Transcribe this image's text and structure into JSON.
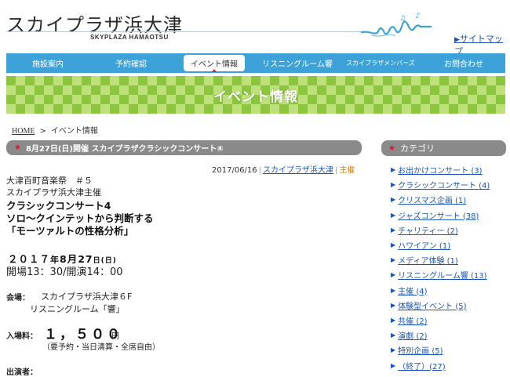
{
  "header": {
    "site_title": "スカイプラザ浜大津",
    "site_subtitle": "SKYPLAZA HAMAOTSU",
    "sitemap_label": "サイトマップ"
  },
  "nav": {
    "items": [
      {
        "label": "施設案内"
      },
      {
        "label": "予約確認"
      },
      {
        "label": "イベント情報"
      },
      {
        "label": "リスニングルーム響"
      },
      {
        "label": "スカイプラザメンバーズ"
      },
      {
        "label": "お問合わせ"
      }
    ],
    "active_index": 2
  },
  "banner": {
    "title": "イベント情報"
  },
  "breadcrumb": {
    "home": "HOME",
    "separator": ">",
    "current": "イベント情報"
  },
  "post": {
    "header": "8月27日(日)開催 スカイプラザクラシックコンサート④",
    "date": "2017/06/16",
    "author": "スカイプラザ浜大津",
    "category": "主催",
    "line1": "大津百町音楽祭　＃５",
    "line2": "スカイプラザ浜大津主催",
    "title1": "クラシックコンサート4",
    "title2": "ソロ～クインテットから判断する",
    "title3": "「モーツァルトの性格分析」",
    "event_year": "２０１７",
    "event_year_unit": "年",
    "event_month_day": "8月27",
    "event_day_unit": "日",
    "event_weekday": "(日)",
    "event_time": "開場13：30/開演14：00",
    "venue_label": "会場：",
    "venue_line1": "スカイプラザ浜大津６F",
    "venue_line2": "リスニングルーム「響」",
    "fee_label": "入場料：",
    "fee_amount": "１，５００",
    "fee_unit": "円",
    "fee_note": "（要予約・当日清算・全席自由）",
    "performers_label": "出演者："
  },
  "sidebar": {
    "title": "カテゴリ",
    "categories": [
      {
        "label": "お出かけコンサート (3)"
      },
      {
        "label": "クラシックコンサート (4)"
      },
      {
        "label": "クリスマス企画 (1)"
      },
      {
        "label": "ジャズコンサート (38)"
      },
      {
        "label": "チャリティー (2)"
      },
      {
        "label": "ハワイアン (1)"
      },
      {
        "label": "メディア体験 (1)"
      },
      {
        "label": "リスニングルーム響 (13)"
      },
      {
        "label": "主催 (4)"
      },
      {
        "label": "体験型イベント (5)"
      },
      {
        "label": "共催 (2)"
      },
      {
        "label": "演劇 (2)"
      },
      {
        "label": "特別企画 (5)"
      },
      {
        "label": "（終了）(27)"
      }
    ]
  },
  "colors": {
    "nav_bg": "#3da2d8",
    "banner_green": "#8cc63f",
    "banner_light": "#bde07a",
    "link_blue": "#1a55b5",
    "category_orange": "#d37b00",
    "star_red": "#e0113b",
    "bar_gray": "#8a8a8a"
  }
}
